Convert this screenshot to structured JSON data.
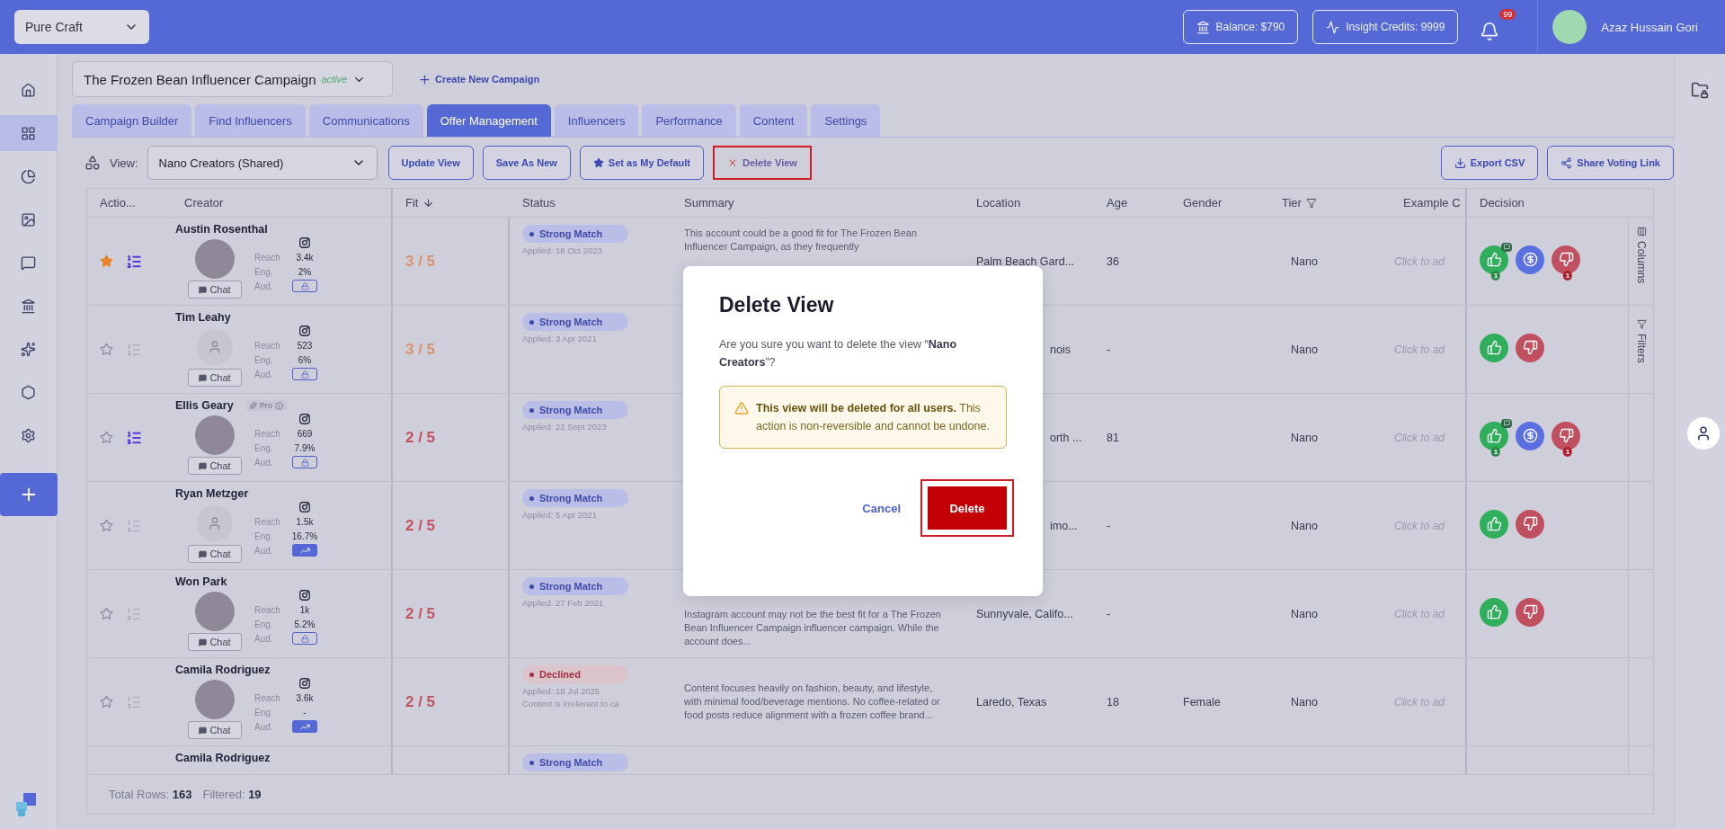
{
  "top_bar": {
    "workspace": "Pure Craft",
    "balance": "Balance: $790",
    "credits": "Insight Credits: 9999",
    "notifications": "99",
    "user": "Azaz Hussain Gori"
  },
  "sidebar": [
    {
      "kind": "home",
      "selected": false
    },
    {
      "kind": "grid",
      "selected": true
    },
    {
      "kind": "pie",
      "selected": false
    },
    {
      "kind": "image",
      "selected": false
    },
    {
      "kind": "chat",
      "selected": false
    },
    {
      "kind": "bank",
      "selected": false
    },
    {
      "kind": "sparkles",
      "selected": false
    },
    {
      "kind": "hexagon",
      "selected": false
    },
    {
      "kind": "settings",
      "selected": false
    },
    {
      "kind": "add",
      "selected": false
    }
  ],
  "campaign": {
    "name": "The Frozen Bean Influencer Campaign",
    "status": "active",
    "create": "Create New Campaign"
  },
  "tabs": [
    {
      "label": "Campaign Builder",
      "selected": false
    },
    {
      "label": "Find Influencers",
      "selected": false
    },
    {
      "label": "Communications",
      "selected": false
    },
    {
      "label": "Offer Management",
      "selected": true
    },
    {
      "label": "Influencers",
      "selected": false
    },
    {
      "label": "Performance",
      "selected": false
    },
    {
      "label": "Content",
      "selected": false
    },
    {
      "label": "Settings",
      "selected": false
    }
  ],
  "toolbar": {
    "view_label": "View:",
    "view": "Nano Creators (Shared)",
    "buttons": [
      {
        "label": "Update View",
        "kind": "plain",
        "highlighted": false
      },
      {
        "label": "Save As New",
        "kind": "plain",
        "highlighted": false
      },
      {
        "label": "Set as My Default",
        "kind": "star",
        "highlighted": false
      },
      {
        "label": "Delete View",
        "kind": "delete",
        "highlighted": true
      }
    ],
    "right_buttons": [
      {
        "label": "Export CSV",
        "kind": "export"
      },
      {
        "label": "Share Voting Link",
        "kind": "share"
      }
    ]
  },
  "table": {
    "columns": [
      {
        "label": "Actio...",
        "kind": "plain"
      },
      {
        "label": "Creator",
        "kind": "plain"
      },
      {
        "label": "Fit",
        "kind": "sort"
      },
      {
        "label": "Status",
        "kind": "plain"
      },
      {
        "label": "Summary",
        "kind": "plain"
      },
      {
        "label": "Location",
        "kind": "plain"
      },
      {
        "label": "Age",
        "kind": "plain"
      },
      {
        "label": "Gender",
        "kind": "plain"
      },
      {
        "label": "Tier",
        "kind": "filter"
      },
      {
        "label": "Example C",
        "kind": "plain"
      },
      {
        "label": "Decision",
        "kind": "plain"
      }
    ],
    "rows": [
      {
        "starred": true,
        "list_active": true,
        "name": "Austin Rosenthal",
        "pro": false,
        "avatar": {
          "kind": "photo"
        },
        "chat": "Chat",
        "stats": [
          {
            "label": "Reach",
            "value": "3.4k"
          },
          {
            "label": "Eng.",
            "value": "2%"
          }
        ],
        "audience": {
          "label": "Aud.",
          "kind": "locked"
        },
        "fit": {
          "text": "3 / 5",
          "color": "#d9926e"
        },
        "status": {
          "kind": "strong",
          "label": "Strong Match"
        },
        "applied": "Applied: 18 Oct 2023",
        "summary": {
          "kind": "cut_bottom",
          "text": "This account could be a good fit for The Frozen Bean Influencer Campaign, as they frequently"
        },
        "location": "Palm Beach Gard...",
        "location_cut": false,
        "age": "36",
        "tier": "Nano",
        "example": "Click to ad",
        "decisions": [
          {
            "kind": "approve",
            "comment": true,
            "count": "1"
          },
          {
            "kind": "pay",
            "comment": false
          },
          {
            "kind": "reject",
            "comment": false,
            "count": "1"
          }
        ]
      },
      {
        "starred": false,
        "list_active": false,
        "name": "Tim Leahy",
        "pro": false,
        "avatar": {
          "kind": "placeholder"
        },
        "chat": "Chat",
        "stats": [
          {
            "label": "Reach",
            "value": "523"
          },
          {
            "label": "Eng.",
            "value": "6%"
          }
        ],
        "audience": {
          "label": "Aud.",
          "kind": "locked"
        },
        "fit": {
          "text": "3 / 5",
          "color": "#d9926e"
        },
        "status": {
          "kind": "strong",
          "label": "Strong Match"
        },
        "applied": "Applied: 3 Apr 2021",
        "location": "nois",
        "location_cut": true,
        "age": "-",
        "tier": "Nano",
        "example": "Click to ad",
        "decisions": [
          {
            "kind": "approve",
            "comment": false
          },
          {
            "kind": "reject",
            "comment": false
          }
        ]
      },
      {
        "starred": false,
        "list_active": true,
        "name": "Ellis Geary",
        "pro": true,
        "pro_label": "Pro",
        "avatar": {
          "kind": "photo"
        },
        "chat": "Chat",
        "stats": [
          {
            "label": "Reach",
            "value": "669"
          },
          {
            "label": "Eng.",
            "value": "7.9%"
          }
        ],
        "audience": {
          "label": "Aud.",
          "kind": "locked"
        },
        "fit": {
          "text": "2 / 5",
          "color": "#c4515f"
        },
        "status": {
          "kind": "strong",
          "label": "Strong Match"
        },
        "applied": "Applied: 22 Sept 2023",
        "location": "orth ...",
        "location_cut": true,
        "age": "81",
        "tier": "Nano",
        "example": "Click to ad",
        "decisions": [
          {
            "kind": "approve",
            "comment": true,
            "count": "1"
          },
          {
            "kind": "pay",
            "comment": false
          },
          {
            "kind": "reject",
            "comment": false,
            "count": "1"
          }
        ]
      },
      {
        "starred": false,
        "list_active": false,
        "name": "Ryan Metzger",
        "pro": false,
        "avatar": {
          "kind": "placeholder"
        },
        "chat": "Chat",
        "stats": [
          {
            "label": "Reach",
            "value": "1.5k"
          },
          {
            "label": "Eng.",
            "value": "16.7%"
          }
        ],
        "audience": {
          "label": "Aud.",
          "kind": "chart"
        },
        "fit": {
          "text": "2 / 5",
          "color": "#c4515f"
        },
        "status": {
          "kind": "strong",
          "label": "Strong Match"
        },
        "applied": "Applied: 5 Apr 2021",
        "location": "imo...",
        "location_cut": true,
        "age": "-",
        "tier": "Nano",
        "example": "Click to ad",
        "decisions": [
          {
            "kind": "approve",
            "comment": false
          },
          {
            "kind": "reject",
            "comment": false
          }
        ]
      },
      {
        "starred": false,
        "list_active": false,
        "name": "Won Park",
        "pro": false,
        "avatar": {
          "kind": "photo"
        },
        "chat": "Chat",
        "stats": [
          {
            "label": "Reach",
            "value": "1k"
          },
          {
            "label": "Eng.",
            "value": "5.2%"
          }
        ],
        "audience": {
          "label": "Aud.",
          "kind": "locked"
        },
        "fit": {
          "text": "2 / 5",
          "color": "#c4515f"
        },
        "status": {
          "kind": "strong",
          "label": "Strong Match"
        },
        "applied": "Applied: 27 Feb 2021",
        "summary": {
          "kind": "cut_top",
          "text": "Instagram account may not be the best fit for a The Frozen Bean Influencer Campaign influencer campaign. While the account does..."
        },
        "location": "Sunnyvale, Califo...",
        "location_cut": false,
        "age": "-",
        "tier": "Nano",
        "example": "Click to ad",
        "decisions": [
          {
            "kind": "approve",
            "comment": false
          },
          {
            "kind": "reject",
            "comment": false
          }
        ]
      },
      {
        "starred": false,
        "list_active": false,
        "name": "Camila Rodriguez",
        "pro": false,
        "avatar": {
          "kind": "photo"
        },
        "chat": "Chat",
        "stats": [
          {
            "label": "Reach",
            "value": "3.6k"
          },
          {
            "label": "Eng.",
            "value": "-"
          }
        ],
        "audience": {
          "label": "Aud.",
          "kind": "chart"
        },
        "fit": {
          "text": "2 / 5",
          "color": "#c4515f"
        },
        "status": {
          "kind": "declined",
          "label": "Declined"
        },
        "applied": "Applied: 18 Jul 2025",
        "note": "Content is irrelevant to ca",
        "summary": {
          "kind": "whole",
          "text": "Content focuses heavily on fashion, beauty, and lifestyle, with minimal food/beverage mentions. No coffee-related or food posts reduce alignment with a frozen coffee brand..."
        },
        "location": "Laredo, Texas",
        "location_cut": false,
        "age": "18",
        "gender": "Female",
        "tier": "Nano",
        "example": "Click to ad",
        "decisions": []
      },
      {
        "name": "Camila Rodriguez",
        "status": {
          "kind": "strong",
          "label": "Strong Match"
        }
      }
    ],
    "footer": {
      "total_label": "Total Rows:",
      "total": "163",
      "filtered_label": "Filtered:",
      "filtered": "19"
    }
  },
  "side_panel": [
    {
      "kind": "columns",
      "label": "Columns"
    },
    {
      "kind": "filters",
      "label": "Filters"
    }
  ],
  "dialog": {
    "title": "Delete View",
    "message": "Are you sure you want to delete the view “**Nano Creators**”?",
    "warning": "**This view will be deleted for all users.** This action is non-reversible and cannot be undone.",
    "cancel": "Cancel",
    "confirm": "Delete",
    "confirm_highlighted": true
  }
}
